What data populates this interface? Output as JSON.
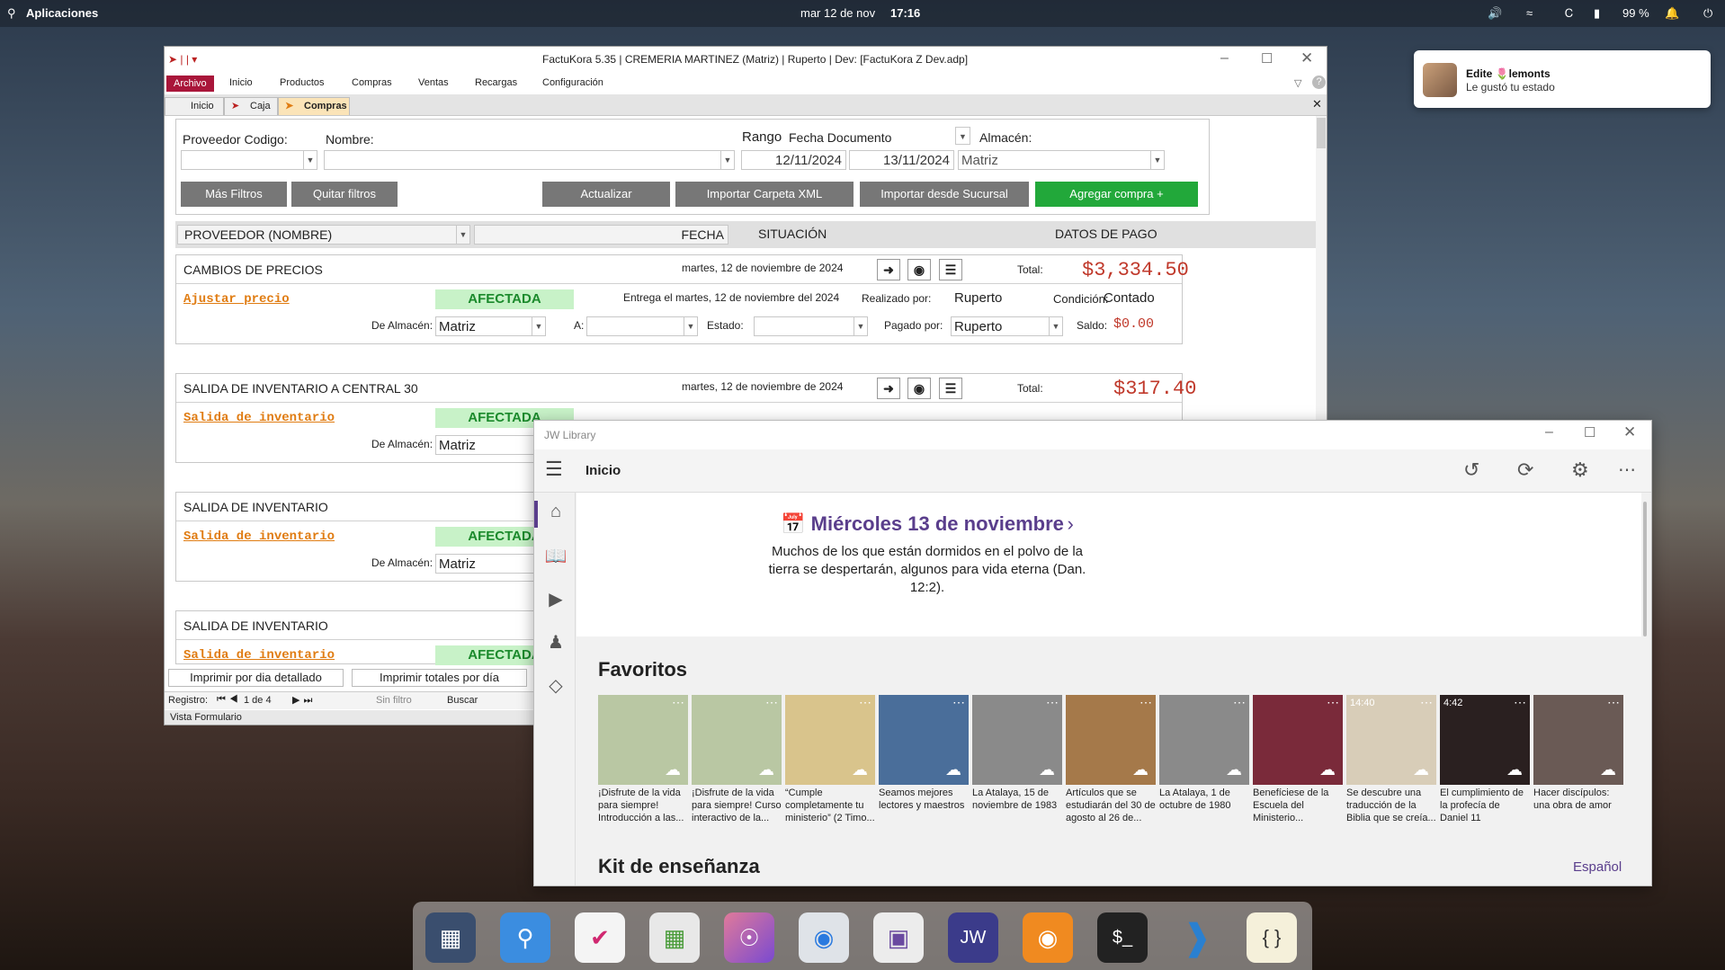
{
  "topbar": {
    "apps_label": "Aplicaciones",
    "date": "mar 12 de nov",
    "time": "17:16",
    "battery": "99 %"
  },
  "notification": {
    "name": "Edite 🌷lemonts",
    "message": "Le gustó tu estado"
  },
  "factukora": {
    "title": "FactuKora 5.35 | CREMERIA MARTINEZ (Matriz) | Ruperto | Dev: [FactuKora Z Dev.adp]",
    "menu": [
      "Archivo",
      "Inicio",
      "Productos",
      "Compras",
      "Ventas",
      "Recargas",
      "Configuración"
    ],
    "tabs": [
      "Inicio",
      "Caja",
      "Compras"
    ],
    "filters": {
      "proveedor_label": "Proveedor Codigo:",
      "nombre_label": "Nombre:",
      "rango_label": "Rango",
      "rango_value": "Fecha Documento",
      "fecha_desde": "12/11/2024",
      "fecha_hasta": "13/11/2024",
      "almacen_label": "Almacén:",
      "almacen_value": "Matriz"
    },
    "buttons": {
      "mas_filtros": "Más Filtros",
      "quitar_filtros": "Quitar filtros",
      "actualizar": "Actualizar",
      "importar_xml": "Importar Carpeta XML",
      "importar_sucursal": "Importar desde Sucursal",
      "agregar_compra": "Agregar compra +"
    },
    "columns": {
      "proveedor": "PROVEEDOR (NOMBRE)",
      "fecha": "FECHA",
      "situacion": "SITUACIÓN",
      "datos_pago": "DATOS DE PAGO"
    },
    "cards": [
      {
        "title": "CAMBIOS DE PRECIOS",
        "date": "martes, 12 de noviembre de 2024",
        "total_label": "Total:",
        "total": "$3,334.50",
        "link": "Ajustar precio",
        "status": "AFECTADA",
        "entrega": "Entrega el martes, 12 de noviembre del 2024",
        "realizado_label": "Realizado por:",
        "realizado": "Ruperto",
        "condicion_label": "Condición:",
        "condicion": "Contado",
        "almacen_label": "De Almacén:",
        "almacen": "Matriz",
        "a_label": "A:",
        "estado_label": "Estado:",
        "pagado_label": "Pagado por:",
        "pagado": "Ruperto",
        "saldo_label": "Saldo:",
        "saldo": "$0.00"
      },
      {
        "title": "SALIDA DE INVENTARIO A CENTRAL 30",
        "date": "martes, 12 de noviembre de 2024",
        "total_label": "Total:",
        "total": "$317.40",
        "link": "Salida de inventario",
        "status": "AFECTADA",
        "almacen_label": "De Almacén:",
        "almacen": "Matriz"
      },
      {
        "title": "SALIDA DE INVENTARIO",
        "link": "Salida de inventario",
        "status": "AFECTADA",
        "almacen_label": "De Almacén:",
        "almacen": "Matriz"
      },
      {
        "title": "SALIDA DE INVENTARIO",
        "link": "Salida de inventario",
        "status": "AFECTADA"
      }
    ],
    "print_buttons": [
      "Imprimir por dia detallado",
      "Imprimir totales por día"
    ],
    "record_nav": {
      "label": "Registro:",
      "position": "1 de 4",
      "filter": "Sin filtro",
      "search": "Buscar"
    },
    "status_bar": "Vista Formulario"
  },
  "jw": {
    "app_title": "JW Library",
    "header": "Inicio",
    "daily_date": "Miércoles 13 de noviembre",
    "daily_text": "Muchos de los que están dormidos en el polvo de la tierra se despertarán, algunos para vida eterna (Dan. 12:2).",
    "favorites_title": "Favoritos",
    "favorites": [
      {
        "caption": "¡Disfrute de la vida para siempre! Introducción a las...",
        "color": "#b9c7a3"
      },
      {
        "caption": "¡Disfrute de la vida para siempre! Curso interactivo de la...",
        "color": "#b9c7a3"
      },
      {
        "caption": "“Cumple completamente tu ministerio” (2 Timo...",
        "color": "#d9c48c"
      },
      {
        "caption": "Seamos mejores lectores y maestros",
        "color": "#4a6e9a"
      },
      {
        "caption": "La Atalaya, 15 de noviembre de 1983",
        "color": "#8a8a8a"
      },
      {
        "caption": "Artículos que se estudiarán del 30 de agosto al 26 de...",
        "color": "#a5794a"
      },
      {
        "caption": "La Atalaya, 1 de octubre de 1980",
        "color": "#8a8a8a"
      },
      {
        "caption": "Benefíciese de la Escuela del Ministerio...",
        "color": "#7a2a3a"
      },
      {
        "caption": "Se descubre una traducción de la Biblia que se creía...",
        "color": "#d8cdb8",
        "duration": "14:40"
      },
      {
        "caption": "El cumplimiento de la profecía de Daniel 11",
        "color": "#2a2020",
        "duration": "4:42"
      },
      {
        "caption": "Hacer discípulos: una obra de amor",
        "color": "#6a5a55"
      }
    ],
    "kit_title": "Kit de enseñanza",
    "language": "Español"
  }
}
